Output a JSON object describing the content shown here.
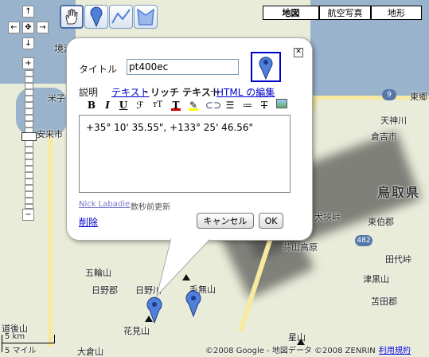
{
  "map_type": {
    "map": "地図",
    "satellite": "航空写真",
    "terrain": "地形"
  },
  "toolbar": {
    "hand": "hand-icon",
    "marker": "marker-icon",
    "line": "line-icon",
    "shape": "shape-icon"
  },
  "pan": {
    "up": "↑",
    "left": "←",
    "right": "→",
    "down": "↓",
    "center": "✥"
  },
  "zoom": {
    "in": "+",
    "out": "−"
  },
  "place_labels": {
    "sakaiminato": "境港",
    "yonago": "米子",
    "yasugi": "安来市",
    "togo": "東郷",
    "tenjin": "天神川",
    "kurayoshi": "倉吉市",
    "tottori": "鳥取県",
    "daisen_pass": "犬挾峠",
    "tohaku": "東伯郡",
    "hiruzen": "蒜山高原",
    "tashiro": "田代峠",
    "tsuguro": "津黒山",
    "tomata": "苫田郡",
    "gokamiyama": "五輪山",
    "hinogun": "日野郡",
    "hinogawa": "日野川",
    "kenashi": "毛無山",
    "hanamiyama": "花見山",
    "hoshiyama": "星山",
    "daikura": "大倉山",
    "dogoyama": "道後山",
    "route9": "9",
    "route482": "482",
    "copyright": "©2008 Google - 地図データ ©2008 ZENRIN -",
    "terms": "利用規約",
    "scale_km": "5 km",
    "scale_mi": "5 マイル"
  },
  "infowindow": {
    "title_label": "タイトル",
    "title_value": "pt400ec",
    "desc_label": "説明",
    "mode_text": "テキスト",
    "mode_rich": "リッチ テキスト",
    "mode_html": "HTML の編集",
    "body_text": "+35° 10' 35.55\", +133° 25' 46.56\"",
    "author": "Nick Labadie",
    "updated": "数秒前更新",
    "delete": "削除",
    "cancel": "キャンセル",
    "ok": "OK",
    "bold": "B",
    "italic": "I",
    "underline": "U",
    "font": "ℱ",
    "size": "ᴛT"
  },
  "colors": {
    "link": "#0000cc",
    "marker": "#4f7fd8",
    "sea": "#99b3cc"
  }
}
